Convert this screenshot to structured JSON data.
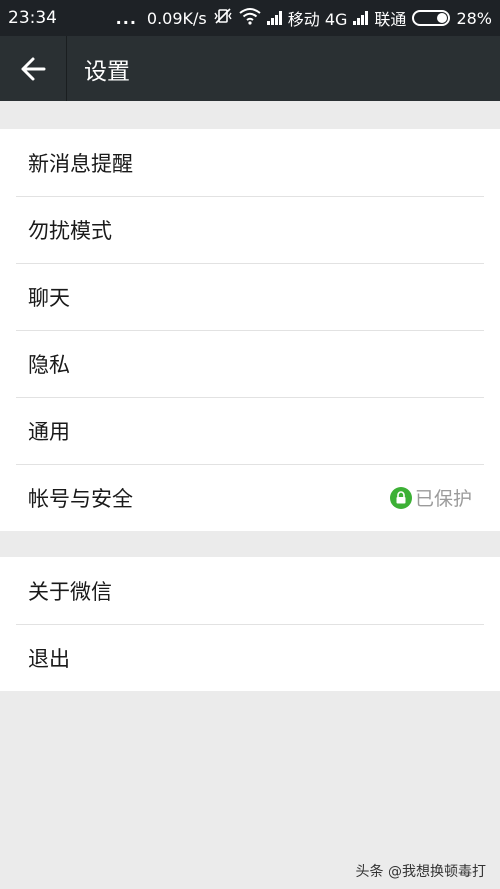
{
  "status_bar": {
    "time": "23:34",
    "dots": "...",
    "net_speed": "0.09K/s",
    "carrier1": "移动 4G",
    "carrier2": "联通",
    "battery": "28%"
  },
  "header": {
    "title": "设置"
  },
  "settings": {
    "group1": [
      {
        "label": "新消息提醒"
      },
      {
        "label": "勿扰模式"
      },
      {
        "label": "聊天"
      },
      {
        "label": "隐私"
      },
      {
        "label": "通用"
      },
      {
        "label": "帐号与安全",
        "status": "已保护"
      }
    ],
    "group2": [
      {
        "label": "关于微信"
      },
      {
        "label": "退出"
      }
    ]
  },
  "watermark": "头条 @我想换顿毒打",
  "colors": {
    "statusbar": "#1e2226",
    "titlebar": "#2a3033",
    "background": "#ebebeb",
    "protect_green": "#3cb035"
  }
}
